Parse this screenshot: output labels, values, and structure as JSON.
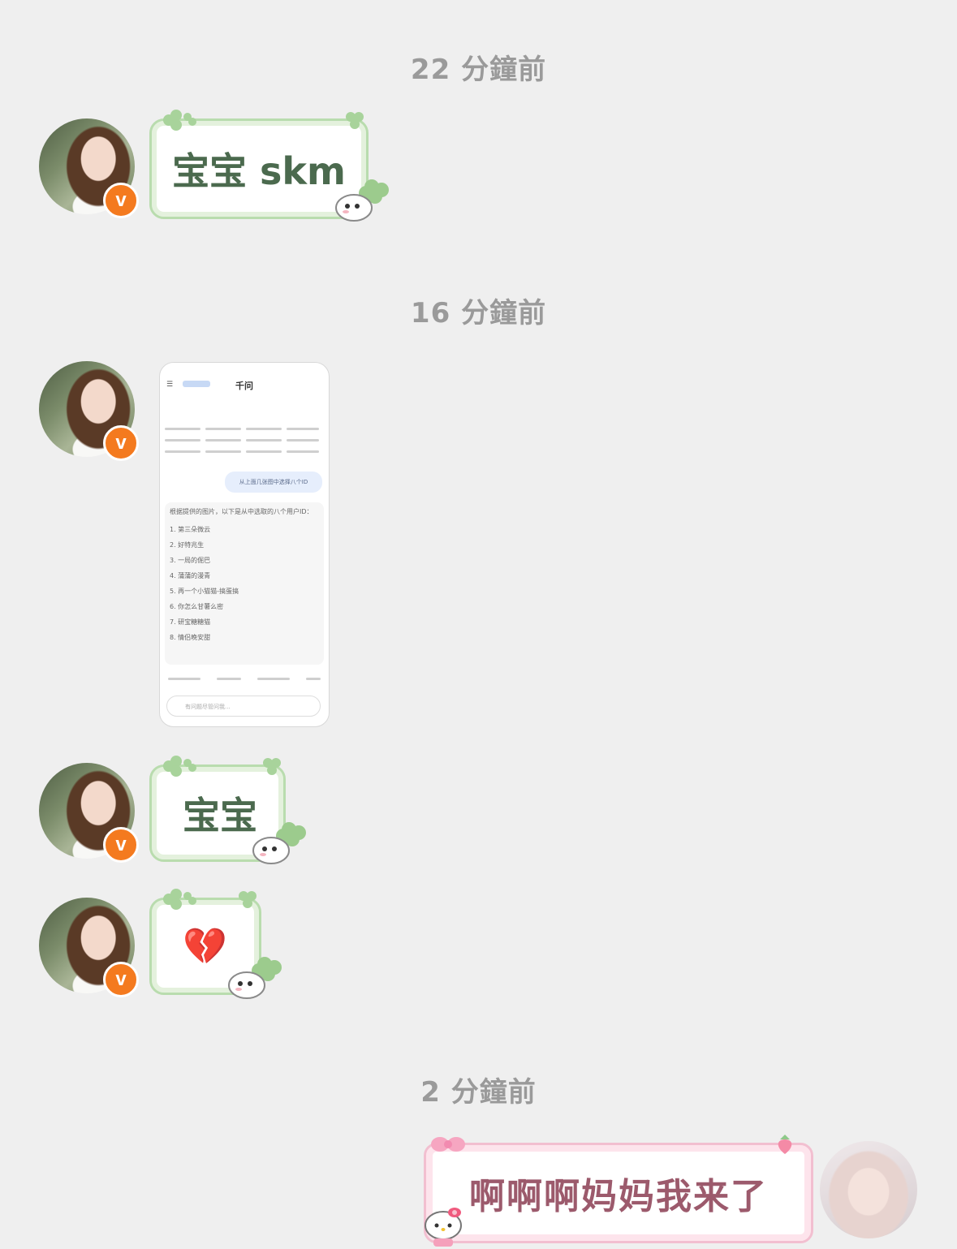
{
  "timestamps": [
    "22 分鐘前",
    "16 分鐘前",
    "2 分鐘前"
  ],
  "messages": {
    "m1": "宝宝 skm",
    "m3": "宝宝",
    "m4": "💔",
    "m5": "啊啊啊妈妈我来了"
  },
  "badge_label": "v",
  "screenshot": {
    "app_title": "千问",
    "query": "从上面几张图中选择八个ID",
    "answer_intro": "根据提供的图片，以下是从中选取的八个用户ID：",
    "items": [
      "1. 第三朵微云",
      "2. 好特兆生",
      "3. 一局的倔巴",
      "4. 蒲蒲的漫青",
      "5. 再一个小猫猫-搞蛋搞",
      "6. 你怎么甘薯么密",
      "7. 研宝糖糖猫",
      "8. 情侣晚安甜"
    ],
    "input_placeholder": "有问题尽管问我..."
  },
  "colors": {
    "background": "#efefef",
    "badge": "#f47a1f",
    "green_bubble_text": "#4b6a4e",
    "pink_bubble_text": "#9c5a6c"
  }
}
